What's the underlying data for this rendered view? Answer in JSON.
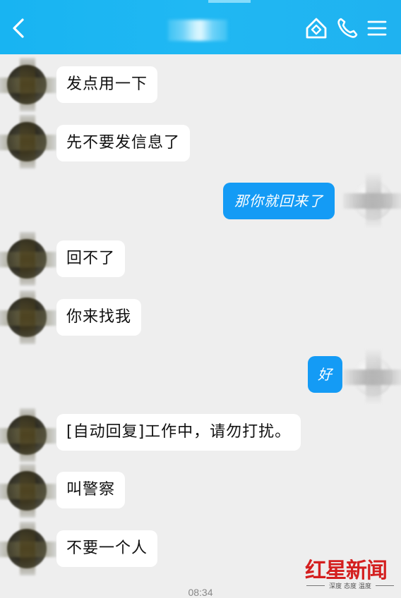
{
  "header": {
    "title": "",
    "back_icon": "chevron-left-icon",
    "home_icon": "home-icon",
    "call_icon": "phone-icon",
    "menu_icon": "menu-icon",
    "bar_color": "#1fb4f2"
  },
  "messages": [
    {
      "sender": "other",
      "text": "发点用一下"
    },
    {
      "sender": "other",
      "text": "先不要发信息了"
    },
    {
      "sender": "me",
      "text": "那你就回来了"
    },
    {
      "sender": "other",
      "text": "回不了"
    },
    {
      "sender": "other",
      "text": "你来找我"
    },
    {
      "sender": "me",
      "text": "好"
    },
    {
      "sender": "other",
      "text": "[自动回复]工作中，请勿打扰。"
    },
    {
      "sender": "other",
      "text": "叫警察"
    },
    {
      "sender": "other",
      "text": "不要一个人"
    }
  ],
  "timestamp": "08:34",
  "watermark": {
    "title": "红星新闻",
    "subtitle": "深度 态度 温度"
  },
  "colors": {
    "my_bubble": "#149bf5",
    "other_bubble": "#ffffff",
    "background": "#eeeeee"
  }
}
